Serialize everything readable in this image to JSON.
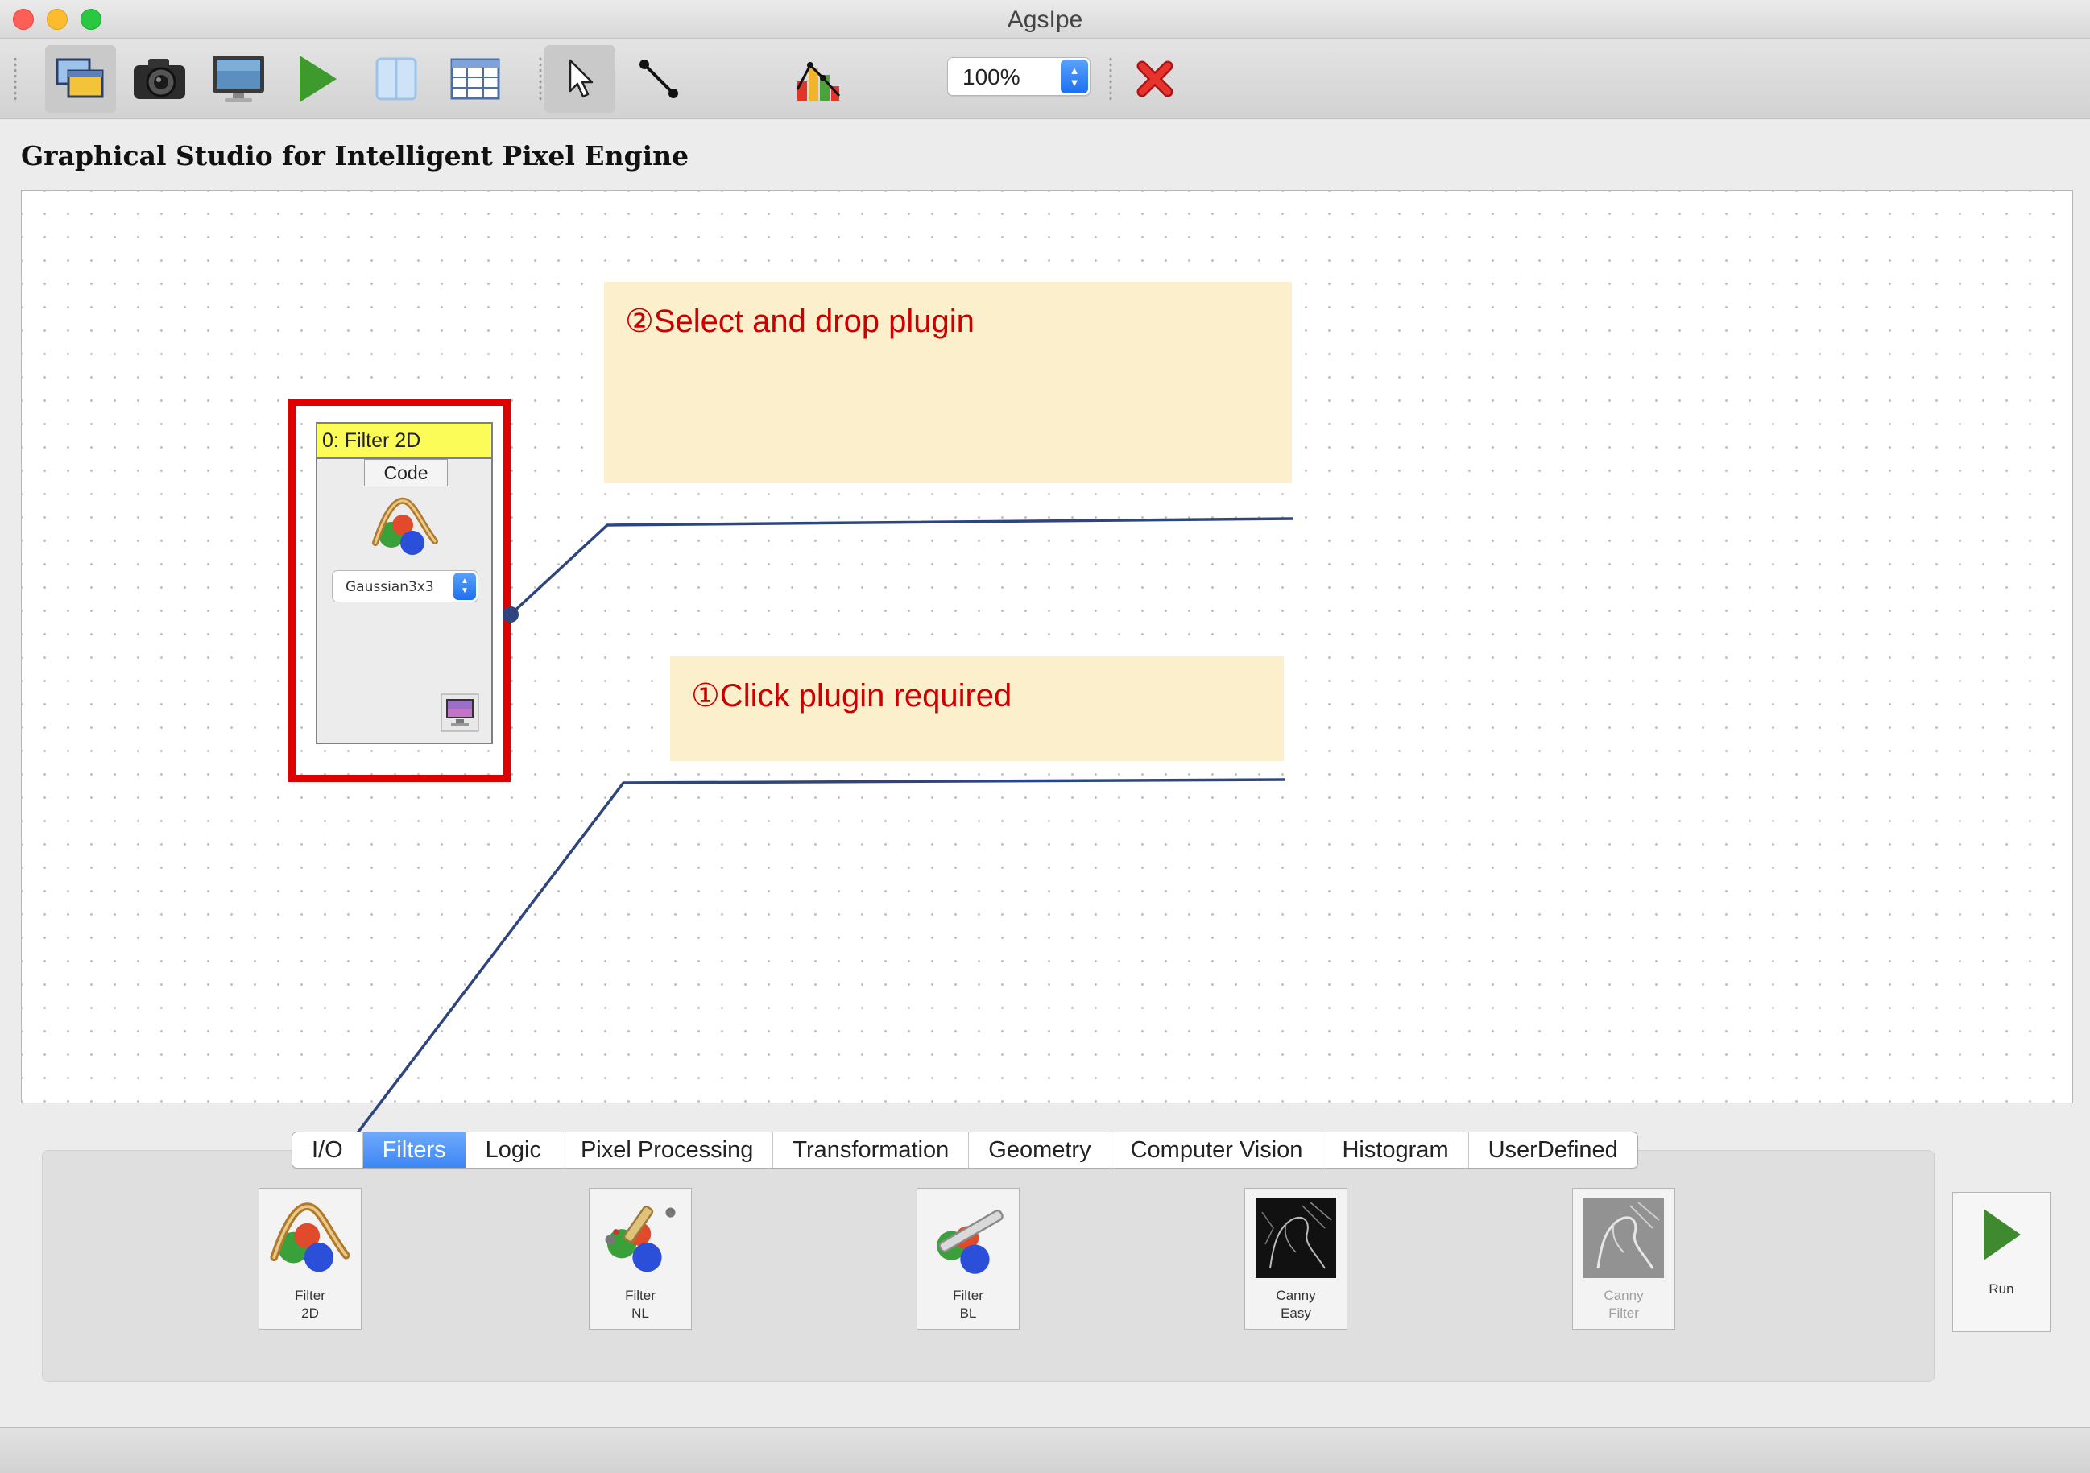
{
  "window": {
    "title": "AgsIpe"
  },
  "toolbar": {
    "buttons": [
      {
        "icon": "windows-icon"
      },
      {
        "icon": "camera-icon"
      },
      {
        "icon": "monitor-icon"
      },
      {
        "icon": "play-icon"
      },
      {
        "icon": "split-view-icon"
      },
      {
        "icon": "table-icon"
      },
      {
        "icon": "pointer-icon"
      },
      {
        "icon": "connector-icon"
      },
      {
        "icon": "bar-chart-icon"
      },
      {
        "icon": "delete-icon"
      }
    ],
    "zoom": "100%"
  },
  "app": {
    "heading": "Graphical Studio for Intelligent Pixel Engine"
  },
  "canvas": {
    "node": {
      "title": "0: Filter 2D",
      "code_label": "Code",
      "filter_value": "Gaussian3x3"
    },
    "callouts": {
      "step2": "②Select and drop plugin",
      "step1": "①Click plugin required"
    }
  },
  "palette": {
    "tabs": [
      "I/O",
      "Filters",
      "Logic",
      "Pixel Processing",
      "Transformation",
      "Geometry",
      "Computer Vision",
      "Histogram",
      "UserDefined"
    ],
    "selected_tab": "Filters",
    "plugins": [
      {
        "label": "Filter\n2D",
        "enabled": true
      },
      {
        "label": "Filter\nNL",
        "enabled": true
      },
      {
        "label": "Filter\nBL",
        "enabled": true
      },
      {
        "label": "Canny\nEasy",
        "enabled": true
      },
      {
        "label": "Canny\nFilter",
        "enabled": false
      }
    ],
    "run_label": "Run"
  },
  "colors": {
    "highlight": "#df0000",
    "callout_bg": "#fcefcb",
    "callout_text": "#cc0000",
    "node_header": "#fcfc59",
    "tab_selected": "#3d86f6",
    "leader_line": "#2e4580"
  }
}
